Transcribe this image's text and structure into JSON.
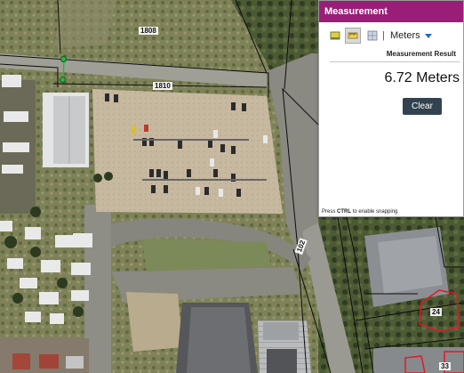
{
  "panel": {
    "title": "Measurement",
    "tools": [
      {
        "name": "area-tool-icon",
        "active": false
      },
      {
        "name": "distance-tool-icon",
        "active": true
      },
      {
        "name": "location-tool-icon",
        "active": false
      }
    ],
    "separator": "|",
    "unit": "Meters",
    "result_title": "Measurement Result",
    "result_value": "6.72 Meters",
    "clear_label": "Clear",
    "snap_hint_prefix": "Press",
    "snap_hint_key": "CTRL",
    "snap_hint_suffix": "to enable snapping",
    "header_color": "#9a1e78",
    "button_color": "#32424f"
  },
  "map": {
    "parcel_labels": [
      "1808",
      "1810",
      "102",
      "24",
      "33"
    ],
    "parcel_line_color": "#111111",
    "highlight_color": "#e0192a"
  }
}
